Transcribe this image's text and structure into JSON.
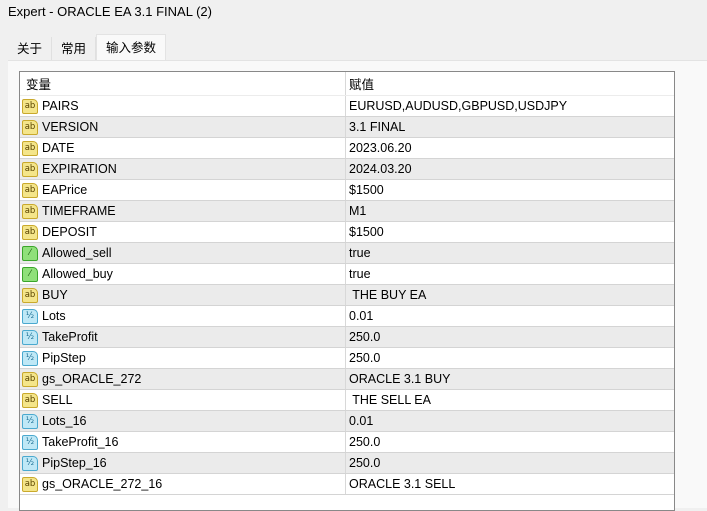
{
  "window": {
    "title": "Expert - ORACLE EA 3.1 FINAL (2)"
  },
  "tabs": [
    {
      "label": "关于"
    },
    {
      "label": "常用"
    },
    {
      "label": "输入参数"
    }
  ],
  "grid": {
    "headers": {
      "variable": "变量",
      "value": "赋值"
    },
    "rows": [
      {
        "icon": "ab",
        "name": "PAIRS",
        "value": "EURUSD,AUDUSD,GBPUSD,USDJPY"
      },
      {
        "icon": "ab",
        "name": "VERSION",
        "value": "3.1 FINAL"
      },
      {
        "icon": "ab",
        "name": "DATE",
        "value": "2023.06.20"
      },
      {
        "icon": "ab",
        "name": "EXPIRATION",
        "value": "2024.03.20"
      },
      {
        "icon": "ab",
        "name": "EAPrice",
        "value": "$1500"
      },
      {
        "icon": "ab",
        "name": "TIMEFRAME",
        "value": "M1"
      },
      {
        "icon": "ab",
        "name": "DEPOSIT",
        "value": "$1500"
      },
      {
        "icon": "bool",
        "name": "Allowed_sell",
        "value": "true"
      },
      {
        "icon": "bool",
        "name": "Allowed_buy",
        "value": "true"
      },
      {
        "icon": "ab",
        "name": "BUY",
        "value": " THE BUY EA"
      },
      {
        "icon": "num",
        "name": "Lots",
        "value": "0.01"
      },
      {
        "icon": "num",
        "name": "TakeProfit",
        "value": "250.0"
      },
      {
        "icon": "num",
        "name": "PipStep",
        "value": "250.0"
      },
      {
        "icon": "ab",
        "name": "gs_ORACLE_272",
        "value": "ORACLE 3.1 BUY"
      },
      {
        "icon": "ab",
        "name": "SELL",
        "value": " THE SELL EA"
      },
      {
        "icon": "num",
        "name": "Lots_16",
        "value": "0.01"
      },
      {
        "icon": "num",
        "name": "TakeProfit_16",
        "value": "250.0"
      },
      {
        "icon": "num",
        "name": "PipStep_16",
        "value": "250.0"
      },
      {
        "icon": "ab",
        "name": "gs_ORACLE_272_16",
        "value": "ORACLE 3.1 SELL"
      }
    ]
  }
}
